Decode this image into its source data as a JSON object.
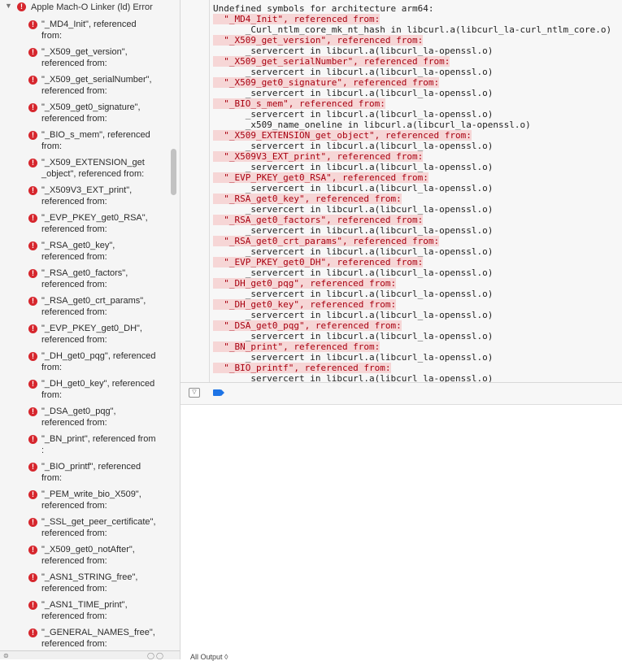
{
  "sidebar": {
    "group_title": "Apple Mach-O Linker (ld) Error",
    "issues": [
      {
        "line1": "\"_MD4_Init\", referenced",
        "line2": "from:"
      },
      {
        "line1": "\"_X509_get_version\",",
        "line2": "referenced from:"
      },
      {
        "line1": "\"_X509_get_serialNumber\",",
        "line2": "referenced from:"
      },
      {
        "line1": "\"_X509_get0_signature\",",
        "line2": "referenced from:"
      },
      {
        "line1": "\"_BIO_s_mem\", referenced",
        "line2": "from:"
      },
      {
        "line1": "\"_X509_EXTENSION_get",
        "line2": "_object\", referenced from:"
      },
      {
        "line1": "\"_X509V3_EXT_print\",",
        "line2": "referenced from:"
      },
      {
        "line1": "\"_EVP_PKEY_get0_RSA\",",
        "line2": "referenced from:"
      },
      {
        "line1": "\"_RSA_get0_key\",",
        "line2": "referenced from:"
      },
      {
        "line1": "\"_RSA_get0_factors\",",
        "line2": "referenced from:"
      },
      {
        "line1": "\"_RSA_get0_crt_params\",",
        "line2": "referenced from:"
      },
      {
        "line1": "\"_EVP_PKEY_get0_DH\",",
        "line2": "referenced from:"
      },
      {
        "line1": "\"_DH_get0_pqg\", referenced",
        "line2": "from:"
      },
      {
        "line1": "\"_DH_get0_key\", referenced",
        "line2": "from:"
      },
      {
        "line1": "\"_DSA_get0_pqg\",",
        "line2": "referenced from:"
      },
      {
        "line1": "\"_BN_print\", referenced from",
        "line2": ":"
      },
      {
        "line1": "\"_BIO_printf\", referenced",
        "line2": "from:"
      },
      {
        "line1": "\"_PEM_write_bio_X509\",",
        "line2": "referenced from:"
      },
      {
        "line1": "\"_SSL_get_peer_certificate\",",
        "line2": "referenced from:"
      },
      {
        "line1": "\"_X509_get0_notAfter\",",
        "line2": "referenced from:"
      },
      {
        "line1": "\"_ASN1_STRING_free\",",
        "line2": "referenced from:"
      },
      {
        "line1": "\"_ASN1_TIME_print\",",
        "line2": "referenced from:"
      },
      {
        "line1": "\"_GENERAL_NAMES_free\",",
        "line2": "referenced from:"
      }
    ],
    "error_glyph": "!",
    "filter_icon": "filter-icon"
  },
  "log": {
    "lines": [
      {
        "text": "Undefined symbols for architecture arm64:",
        "sym": false
      },
      {
        "text": "  \"_MD4_Init\", referenced from:",
        "sym": true
      },
      {
        "text": "      _Curl_ntlm_core_mk_nt_hash in libcurl.a(libcurl_la-curl_ntlm_core.o)",
        "sym": false
      },
      {
        "text": "  \"_X509_get_version\", referenced from:",
        "sym": true
      },
      {
        "text": "      _servercert in libcurl.a(libcurl_la-openssl.o)",
        "sym": false
      },
      {
        "text": "  \"_X509_get_serialNumber\", referenced from:",
        "sym": true
      },
      {
        "text": "      _servercert in libcurl.a(libcurl_la-openssl.o)",
        "sym": false
      },
      {
        "text": "  \"_X509_get0_signature\", referenced from:",
        "sym": true
      },
      {
        "text": "      _servercert in libcurl.a(libcurl_la-openssl.o)",
        "sym": false
      },
      {
        "text": "  \"_BIO_s_mem\", referenced from:",
        "sym": true
      },
      {
        "text": "      _servercert in libcurl.a(libcurl_la-openssl.o)",
        "sym": false
      },
      {
        "text": "      _x509_name_oneline in libcurl.a(libcurl_la-openssl.o)",
        "sym": false
      },
      {
        "text": "  \"_X509_EXTENSION_get_object\", referenced from:",
        "sym": true
      },
      {
        "text": "      _servercert in libcurl.a(libcurl_la-openssl.o)",
        "sym": false
      },
      {
        "text": "  \"_X509V3_EXT_print\", referenced from:",
        "sym": true
      },
      {
        "text": "      _servercert in libcurl.a(libcurl_la-openssl.o)",
        "sym": false
      },
      {
        "text": "  \"_EVP_PKEY_get0_RSA\", referenced from:",
        "sym": true
      },
      {
        "text": "      _servercert in libcurl.a(libcurl_la-openssl.o)",
        "sym": false
      },
      {
        "text": "  \"_RSA_get0_key\", referenced from:",
        "sym": true
      },
      {
        "text": "      _servercert in libcurl.a(libcurl_la-openssl.o)",
        "sym": false
      },
      {
        "text": "  \"_RSA_get0_factors\", referenced from:",
        "sym": true
      },
      {
        "text": "      _servercert in libcurl.a(libcurl_la-openssl.o)",
        "sym": false
      },
      {
        "text": "  \"_RSA_get0_crt_params\", referenced from:",
        "sym": true
      },
      {
        "text": "      _servercert in libcurl.a(libcurl_la-openssl.o)",
        "sym": false
      },
      {
        "text": "  \"_EVP_PKEY_get0_DH\", referenced from:",
        "sym": true
      },
      {
        "text": "      _servercert in libcurl.a(libcurl_la-openssl.o)",
        "sym": false
      },
      {
        "text": "  \"_DH_get0_pqg\", referenced from:",
        "sym": true
      },
      {
        "text": "      _servercert in libcurl.a(libcurl_la-openssl.o)",
        "sym": false
      },
      {
        "text": "  \"_DH_get0_key\", referenced from:",
        "sym": true
      },
      {
        "text": "      _servercert in libcurl.a(libcurl_la-openssl.o)",
        "sym": false
      },
      {
        "text": "  \"_DSA_get0_pqg\", referenced from:",
        "sym": true
      },
      {
        "text": "      _servercert in libcurl.a(libcurl_la-openssl.o)",
        "sym": false
      },
      {
        "text": "  \"_BN_print\", referenced from:",
        "sym": true
      },
      {
        "text": "      _servercert in libcurl.a(libcurl_la-openssl.o)",
        "sym": false
      },
      {
        "text": "  \"_BIO_printf\", referenced from:",
        "sym": true
      },
      {
        "text": "      _servercert in libcurl.a(libcurl_la-openssl.o)",
        "sym": false
      }
    ]
  },
  "debug_bar": {
    "toggle_icon": "hide-debug-area-icon",
    "toggle_glyph": "▽",
    "breakpoint_icon": "breakpoint-icon"
  },
  "console": {
    "footer_text": "All Output ◊"
  },
  "colors": {
    "error": "#d6262d",
    "symbol_highlight": "#f6d6d6",
    "symbol_text": "#a80010",
    "breakpoint": "#1e74e6"
  }
}
